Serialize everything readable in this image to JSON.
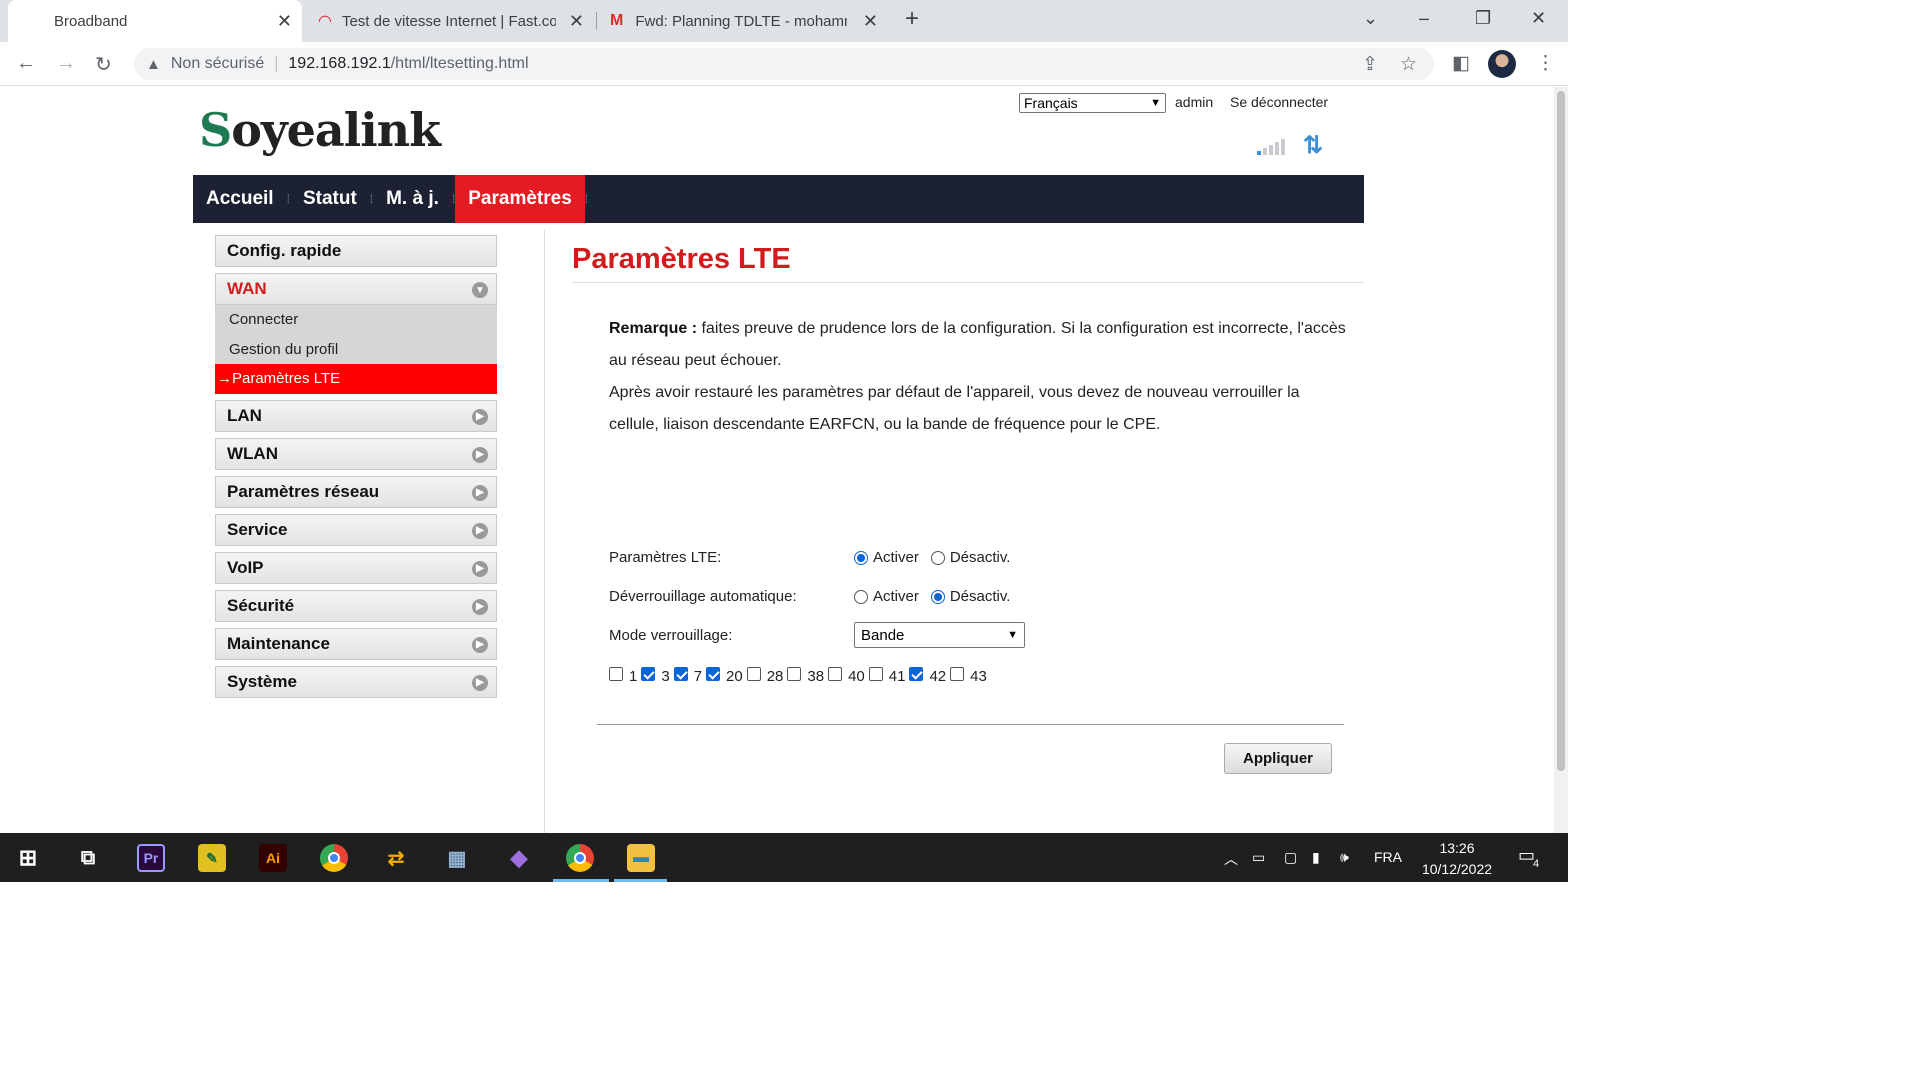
{
  "browser": {
    "tabs": [
      {
        "title": "Broadband",
        "active": true
      },
      {
        "title": "Test de vitesse Internet | Fast.com",
        "active": false
      },
      {
        "title": "Fwd: Planning TDLTE - mohammed",
        "active": false
      }
    ],
    "new_tab": "+",
    "url_security": "Non sécurisé",
    "url_host": "192.168.192.1",
    "url_path": "/html/ltesetting.html"
  },
  "header": {
    "logo_text": "Soyealink",
    "language": "Français",
    "user": "admin",
    "logout": "Se déconnecter",
    "signal_bars_active": 1
  },
  "menu": {
    "items": [
      "Accueil",
      "Statut",
      "M. à j.",
      "Paramètres"
    ],
    "active": "Paramètres"
  },
  "sidebar": {
    "quick_config": "Config. rapide",
    "wan": {
      "label": "WAN",
      "subitems": [
        "Connecter",
        "Gestion du profil",
        "→Paramètres LTE"
      ]
    },
    "items": [
      "LAN",
      "WLAN",
      "Paramètres réseau",
      "Service",
      "VoIP",
      "Sécurité",
      "Maintenance",
      "Système"
    ]
  },
  "content": {
    "title": "Paramètres LTE",
    "remark_label": "Remarque :",
    "remark_text": " faites preuve de prudence lors de la configuration. Si la configuration est incorrecte, l'accès au réseau peut échouer.",
    "remark_text2": "Après avoir restauré les paramètres par défaut de l'appareil, vous devez de nouveau verrouiller la cellule, liaison descendante EARFCN, ou la bande de fréquence pour le CPE.",
    "lte_label": "Paramètres LTE:",
    "lte_on": "Activer",
    "lte_off": "Désactiv.",
    "lte_value": "Activer",
    "unlock_label": "Déverrouillage automatique:",
    "unlock_on": "Activer",
    "unlock_off": "Désactiv.",
    "unlock_value": "Désactiv.",
    "lock_mode_label": "Mode verrouillage:",
    "lock_mode_value": "Bande",
    "bands": [
      {
        "num": "1",
        "checked": false
      },
      {
        "num": "3",
        "checked": true
      },
      {
        "num": "7",
        "checked": true
      },
      {
        "num": "20",
        "checked": true
      },
      {
        "num": "28",
        "checked": false
      },
      {
        "num": "38",
        "checked": false
      },
      {
        "num": "40",
        "checked": false
      },
      {
        "num": "41",
        "checked": false
      },
      {
        "num": "42",
        "checked": true
      },
      {
        "num": "43",
        "checked": false
      }
    ],
    "apply": "Appliquer"
  },
  "taskbar": {
    "language": "FRA",
    "time": "13:26",
    "date": "10/12/2022",
    "notifications": "4"
  }
}
